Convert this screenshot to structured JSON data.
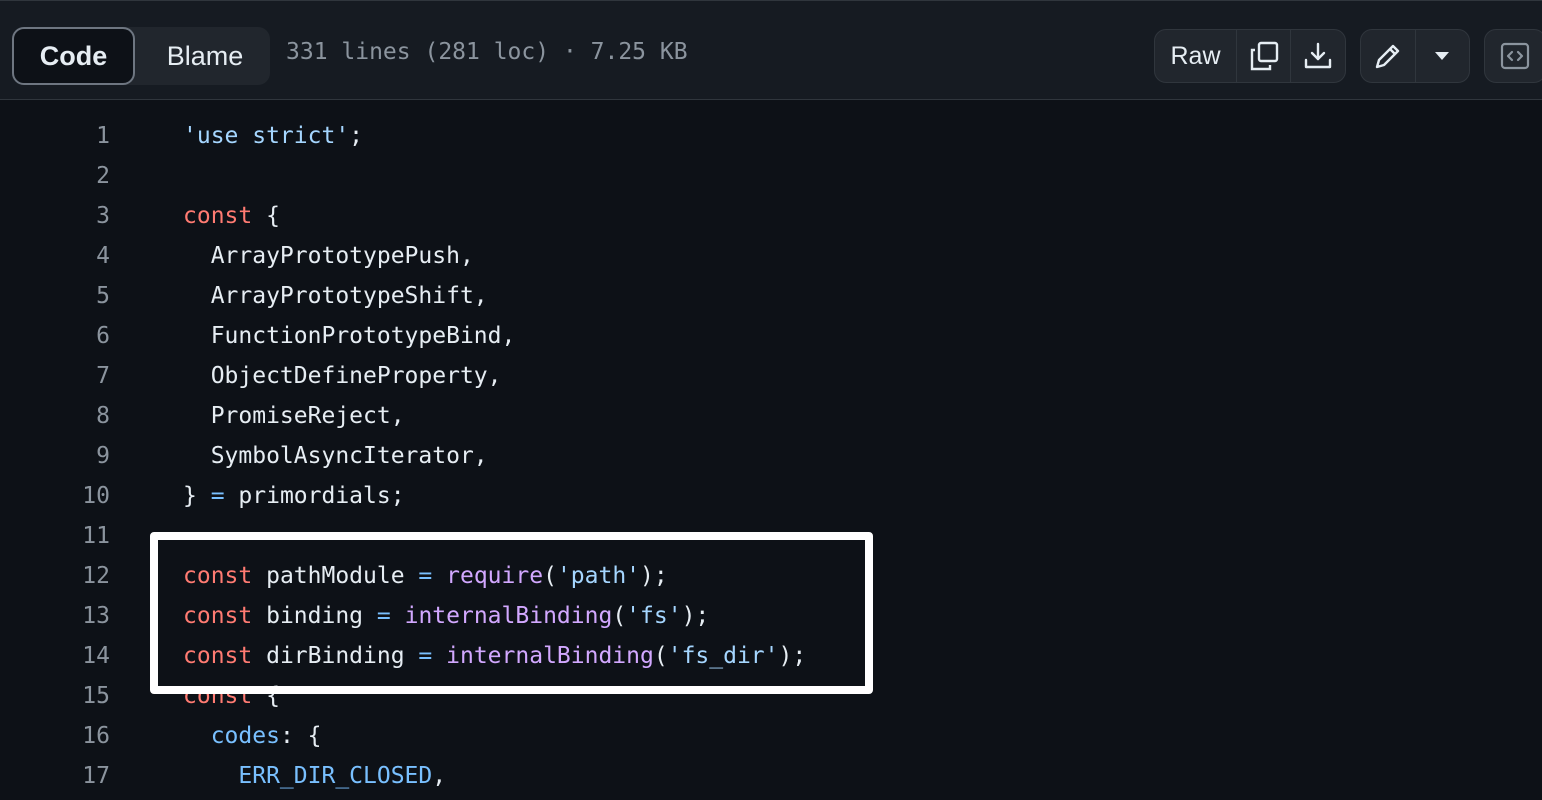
{
  "header": {
    "tabs": [
      {
        "label": "Code",
        "active": true
      },
      {
        "label": "Blame",
        "active": false
      }
    ],
    "file_info": "331 lines (281 loc) · 7.25 KB",
    "raw_label": "Raw",
    "icons": [
      "copy-icon",
      "download-icon",
      "pencil-icon",
      "triangle-down-icon",
      "code-square-icon"
    ]
  },
  "code": {
    "lines": [
      {
        "n": "1",
        "tokens": [
          {
            "t": "'use strict'",
            "c": "s"
          },
          {
            "t": ";",
            "c": ""
          }
        ]
      },
      {
        "n": "2",
        "tokens": []
      },
      {
        "n": "3",
        "tokens": [
          {
            "t": "const",
            "c": "k"
          },
          {
            "t": " {",
            "c": ""
          }
        ]
      },
      {
        "n": "4",
        "tokens": [
          {
            "t": "  ArrayPrototypePush,",
            "c": ""
          }
        ]
      },
      {
        "n": "5",
        "tokens": [
          {
            "t": "  ArrayPrototypeShift,",
            "c": ""
          }
        ]
      },
      {
        "n": "6",
        "tokens": [
          {
            "t": "  FunctionPrototypeBind,",
            "c": ""
          }
        ]
      },
      {
        "n": "7",
        "tokens": [
          {
            "t": "  ObjectDefineProperty,",
            "c": ""
          }
        ]
      },
      {
        "n": "8",
        "tokens": [
          {
            "t": "  PromiseReject,",
            "c": ""
          }
        ]
      },
      {
        "n": "9",
        "tokens": [
          {
            "t": "  SymbolAsyncIterator,",
            "c": ""
          }
        ]
      },
      {
        "n": "10",
        "tokens": [
          {
            "t": "} ",
            "c": ""
          },
          {
            "t": "=",
            "c": "c"
          },
          {
            "t": " primordials;",
            "c": ""
          }
        ]
      },
      {
        "n": "11",
        "tokens": []
      },
      {
        "n": "12",
        "tokens": [
          {
            "t": "const",
            "c": "k"
          },
          {
            "t": " pathModule ",
            "c": ""
          },
          {
            "t": "=",
            "c": "c"
          },
          {
            "t": " ",
            "c": ""
          },
          {
            "t": "require",
            "c": "f"
          },
          {
            "t": "(",
            "c": ""
          },
          {
            "t": "'path'",
            "c": "s"
          },
          {
            "t": ");",
            "c": ""
          }
        ]
      },
      {
        "n": "13",
        "tokens": [
          {
            "t": "const",
            "c": "k"
          },
          {
            "t": " binding ",
            "c": ""
          },
          {
            "t": "=",
            "c": "c"
          },
          {
            "t": " ",
            "c": ""
          },
          {
            "t": "internalBinding",
            "c": "f"
          },
          {
            "t": "(",
            "c": ""
          },
          {
            "t": "'fs'",
            "c": "s"
          },
          {
            "t": ");",
            "c": ""
          }
        ]
      },
      {
        "n": "14",
        "tokens": [
          {
            "t": "const",
            "c": "k"
          },
          {
            "t": " dirBinding ",
            "c": ""
          },
          {
            "t": "=",
            "c": "c"
          },
          {
            "t": " ",
            "c": ""
          },
          {
            "t": "internalBinding",
            "c": "f"
          },
          {
            "t": "(",
            "c": ""
          },
          {
            "t": "'fs_dir'",
            "c": "s"
          },
          {
            "t": ");",
            "c": ""
          }
        ]
      },
      {
        "n": "15",
        "tokens": [
          {
            "t": "const",
            "c": "k"
          },
          {
            "t": " {",
            "c": ""
          }
        ]
      },
      {
        "n": "16",
        "tokens": [
          {
            "t": "  ",
            "c": ""
          },
          {
            "t": "codes",
            "c": "c"
          },
          {
            "t": ": {",
            "c": ""
          }
        ]
      },
      {
        "n": "17",
        "tokens": [
          {
            "t": "    ",
            "c": ""
          },
          {
            "t": "ERR_DIR_CLOSED",
            "c": "c"
          },
          {
            "t": ",",
            "c": ""
          }
        ]
      }
    ]
  },
  "colors": {
    "background": "#0d1117",
    "keyword": "#ff7b72",
    "string": "#a5d6ff",
    "function": "#d2a8ff",
    "constant": "#79c0ff",
    "line_number": "#8b949e"
  }
}
